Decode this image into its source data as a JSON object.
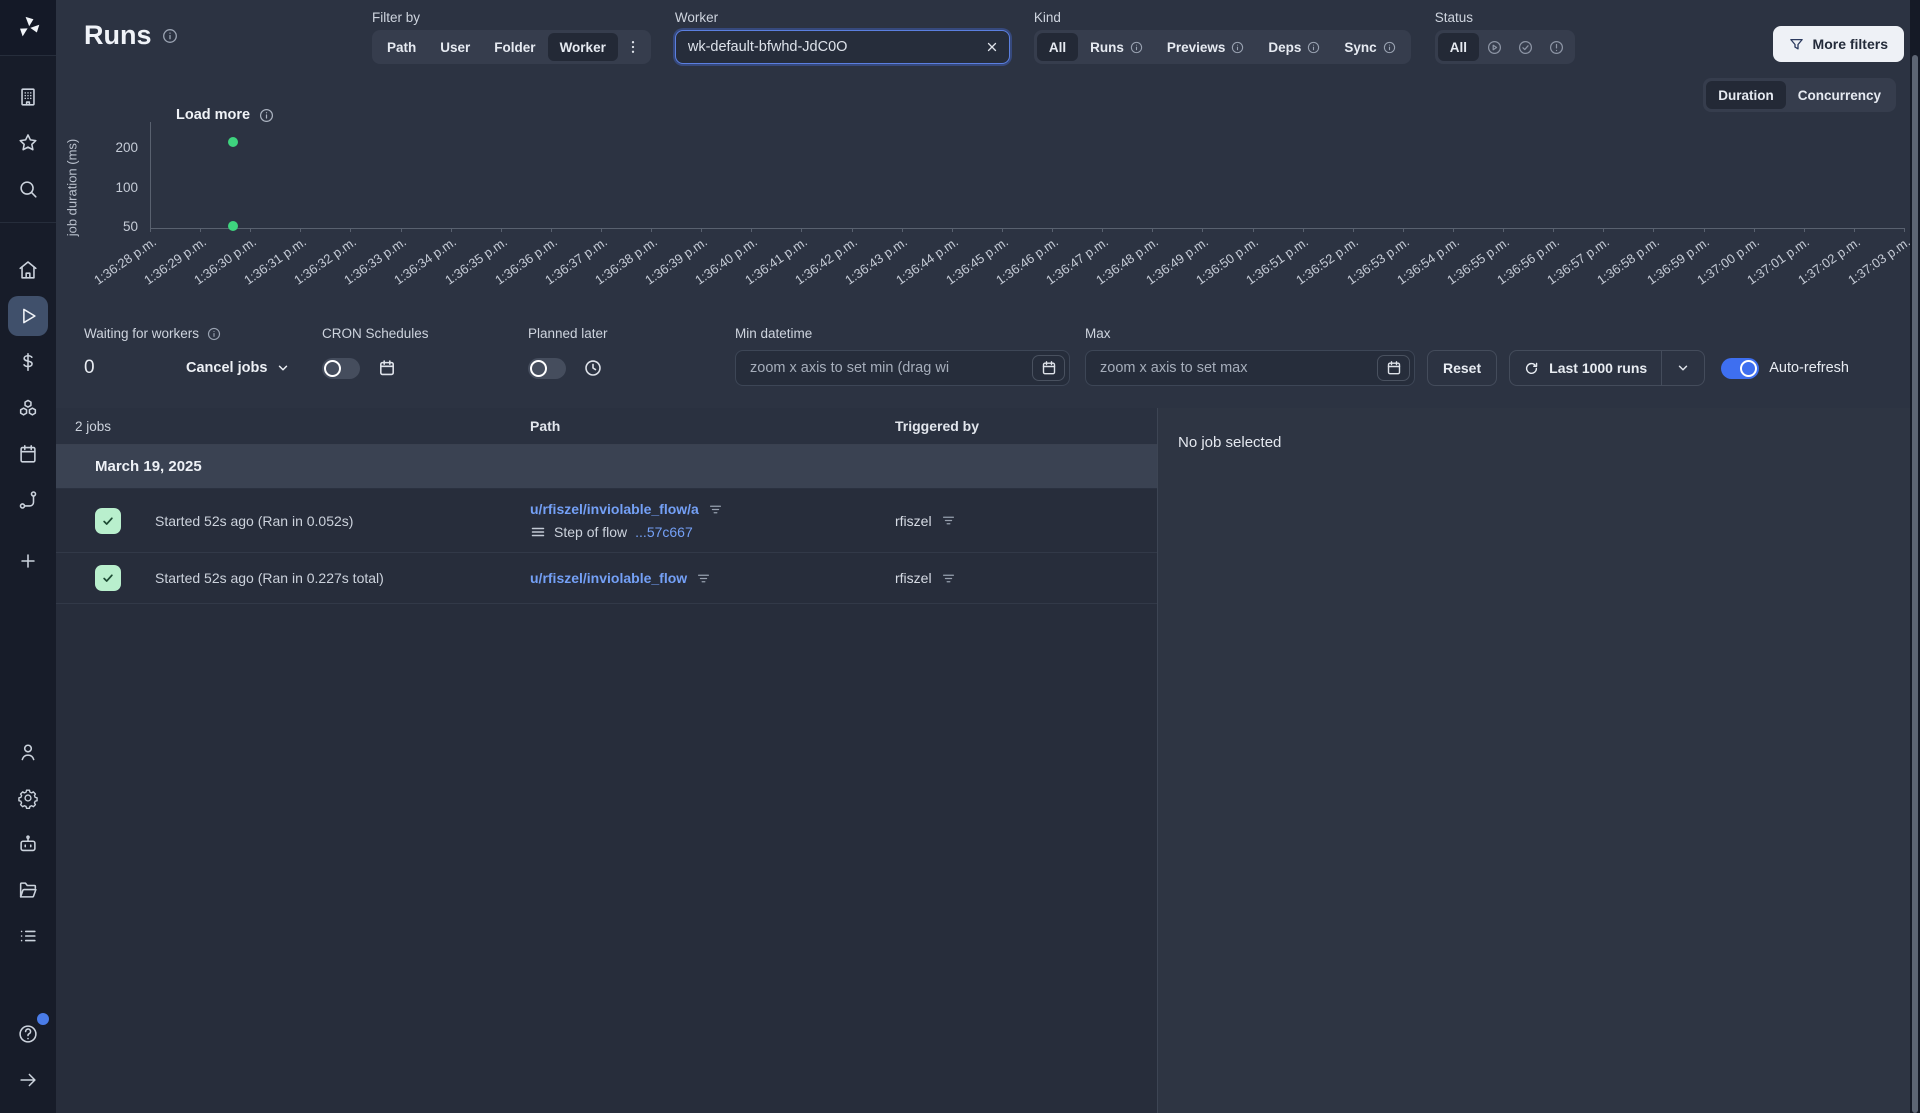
{
  "header": {
    "title": "Runs",
    "filter_by": {
      "label": "Filter by",
      "options": [
        "Path",
        "User",
        "Folder",
        "Worker"
      ],
      "selected": "Worker"
    },
    "worker": {
      "label": "Worker",
      "value": "wk-default-bfwhd-JdC0O"
    },
    "kind": {
      "label": "Kind",
      "selected": "All",
      "options": [
        {
          "label": "All",
          "info": false
        },
        {
          "label": "Runs",
          "info": true
        },
        {
          "label": "Previews",
          "info": true
        },
        {
          "label": "Deps",
          "info": true
        },
        {
          "label": "Sync",
          "info": true
        }
      ]
    },
    "status": {
      "label": "Status",
      "selected": "All",
      "icon_options": [
        "running",
        "success",
        "failure"
      ]
    },
    "more_filters_label": "More filters"
  },
  "view_toggle": {
    "options": [
      "Duration",
      "Concurrency"
    ],
    "selected": "Duration"
  },
  "chart_ui": {
    "load_more_label": "Load more"
  },
  "chart_data": {
    "type": "scatter",
    "ylabel": "job duration (ms)",
    "y_scale": "log",
    "y_ticks": [
      200,
      100,
      50
    ],
    "x_ticks": [
      "1:36:28 p.m.",
      "1:36:29 p.m.",
      "1:36:30 p.m.",
      "1:36:31 p.m.",
      "1:36:32 p.m.",
      "1:36:33 p.m.",
      "1:36:34 p.m.",
      "1:36:35 p.m.",
      "1:36:36 p.m.",
      "1:36:37 p.m.",
      "1:36:38 p.m.",
      "1:36:39 p.m.",
      "1:36:40 p.m.",
      "1:36:41 p.m.",
      "1:36:42 p.m.",
      "1:36:43 p.m.",
      "1:36:44 p.m.",
      "1:36:45 p.m.",
      "1:36:46 p.m.",
      "1:36:47 p.m.",
      "1:36:48 p.m.",
      "1:36:49 p.m.",
      "1:36:50 p.m.",
      "1:36:51 p.m.",
      "1:36:52 p.m.",
      "1:36:53 p.m.",
      "1:36:54 p.m.",
      "1:36:55 p.m.",
      "1:36:56 p.m.",
      "1:36:57 p.m.",
      "1:36:58 p.m.",
      "1:36:59 p.m.",
      "1:37:00 p.m.",
      "1:37:01 p.m.",
      "1:37:02 p.m.",
      "1:37:03 p.m."
    ],
    "points": [
      {
        "time": "1:36:30 p.m.",
        "t": 1.66,
        "duration_ms": 227,
        "color": "#3ed47e"
      },
      {
        "time": "1:36:30 p.m.",
        "t": 1.66,
        "duration_ms": 52,
        "color": "#3ed47e"
      }
    ],
    "grid": false,
    "legend": null
  },
  "controls": {
    "waiting_label": "Waiting for workers",
    "waiting_value": "0",
    "cancel_jobs_label": "Cancel jobs",
    "cron_label": "CRON Schedules",
    "planned_label": "Planned later",
    "min_label": "Min datetime",
    "min_placeholder": "zoom x axis to set min (drag wi",
    "max_label": "Max",
    "max_placeholder": "zoom x axis to set max",
    "reset_label": "Reset",
    "last_runs_label": "Last 1000 runs",
    "auto_refresh_label": "Auto-refresh"
  },
  "table": {
    "count_label": "2 jobs",
    "columns": {
      "path": "Path",
      "triggered_by": "Triggered by"
    },
    "date_header": "March 19, 2025",
    "rows": [
      {
        "status": "success",
        "started": "Started 52s ago (Ran in 0.052s)",
        "path": "u/rfiszel/inviolable_flow/a",
        "step_label": "Step of flow",
        "step_id": "...57c667",
        "triggered_by": "rfiszel"
      },
      {
        "status": "success",
        "started": "Started 52s ago (Ran in 0.227s total)",
        "path": "u/rfiszel/inviolable_flow",
        "triggered_by": "rfiszel"
      }
    ]
  },
  "detail_panel": {
    "empty_label": "No job selected"
  },
  "sidebar": {
    "groups": [
      {
        "name": "workspace",
        "items": [
          {
            "id": "workspace",
            "icon": "building"
          },
          {
            "id": "favorites",
            "icon": "star"
          },
          {
            "id": "search",
            "icon": "search"
          }
        ]
      },
      {
        "name": "primary",
        "items": [
          {
            "id": "home",
            "icon": "home"
          },
          {
            "id": "runs",
            "icon": "play",
            "active": true
          },
          {
            "id": "variables",
            "icon": "dollar"
          },
          {
            "id": "resources",
            "icon": "boxes"
          },
          {
            "id": "schedules",
            "icon": "calendar"
          },
          {
            "id": "triggers",
            "icon": "route"
          },
          {
            "id": "create",
            "icon": "plus"
          }
        ]
      },
      {
        "name": "admin",
        "items": [
          {
            "id": "users",
            "icon": "user"
          },
          {
            "id": "settings",
            "icon": "settings"
          },
          {
            "id": "workers",
            "icon": "bot"
          },
          {
            "id": "folders",
            "icon": "folder"
          },
          {
            "id": "audit-logs",
            "icon": "list"
          }
        ]
      },
      {
        "name": "footer",
        "items": [
          {
            "id": "help",
            "icon": "help",
            "badge": true
          },
          {
            "id": "collapse",
            "icon": "arrow-right"
          }
        ]
      }
    ]
  },
  "colors": {
    "accent_blue": "#3e6ff0",
    "success_green": "#3ed47e",
    "link_blue": "#74a0f6",
    "badge_green_bg": "#b9efcd"
  }
}
